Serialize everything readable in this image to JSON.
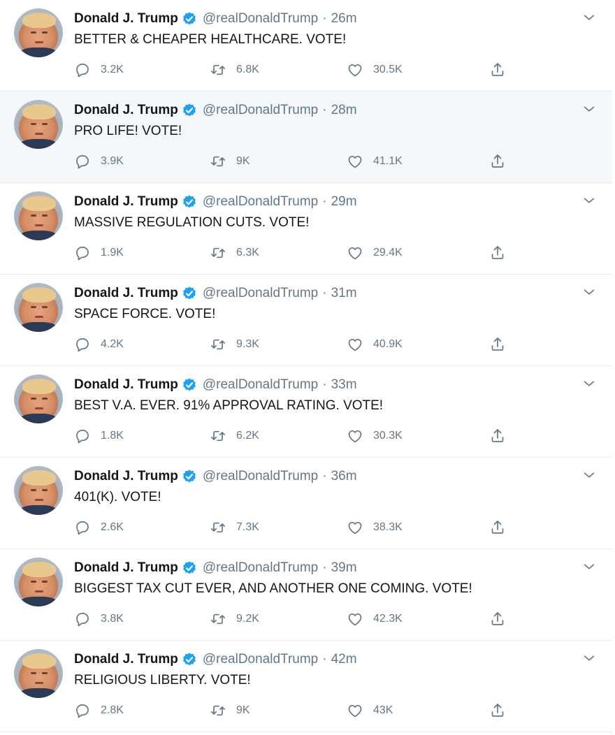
{
  "colors": {
    "name": "#14171a",
    "secondary": "#657786",
    "verified": "#1da1f2",
    "divider": "#e6ecf0",
    "hover_bg": "#f5f8fa"
  },
  "icons": {
    "reply": "reply-icon",
    "retweet": "retweet-icon",
    "like": "like-icon",
    "share": "share-icon",
    "verified": "verified-badge-icon",
    "caret": "chevron-down-icon"
  },
  "tweets": [
    {
      "name": "Donald J. Trump",
      "handle": "@realDonaldTrump",
      "sep": "·",
      "time": "26m",
      "text": "BETTER & CHEAPER HEALTHCARE. VOTE!",
      "replies": "3.2K",
      "retweets": "6.8K",
      "likes": "30.5K"
    },
    {
      "name": "Donald J. Trump",
      "handle": "@realDonaldTrump",
      "sep": "·",
      "time": "28m",
      "text": "PRO LIFE! VOTE!",
      "replies": "3.9K",
      "retweets": "9K",
      "likes": "41.1K"
    },
    {
      "name": "Donald J. Trump",
      "handle": "@realDonaldTrump",
      "sep": "·",
      "time": "29m",
      "text": "MASSIVE REGULATION CUTS. VOTE!",
      "replies": "1.9K",
      "retweets": "6.3K",
      "likes": "29.4K"
    },
    {
      "name": "Donald J. Trump",
      "handle": "@realDonaldTrump",
      "sep": "·",
      "time": "31m",
      "text": "SPACE FORCE. VOTE!",
      "replies": "4.2K",
      "retweets": "9.3K",
      "likes": "40.9K"
    },
    {
      "name": "Donald J. Trump",
      "handle": "@realDonaldTrump",
      "sep": "·",
      "time": "33m",
      "text": "BEST V.A. EVER. 91% APPROVAL RATING. VOTE!",
      "replies": "1.8K",
      "retweets": "6.2K",
      "likes": "30.3K"
    },
    {
      "name": "Donald J. Trump",
      "handle": "@realDonaldTrump",
      "sep": "·",
      "time": "36m",
      "text": "401(K). VOTE!",
      "replies": "2.6K",
      "retweets": "7.3K",
      "likes": "38.3K"
    },
    {
      "name": "Donald J. Trump",
      "handle": "@realDonaldTrump",
      "sep": "·",
      "time": "39m",
      "text": "BIGGEST TAX CUT EVER, AND ANOTHER ONE COMING. VOTE!",
      "replies": "3.8K",
      "retweets": "9.2K",
      "likes": "42.3K"
    },
    {
      "name": "Donald J. Trump",
      "handle": "@realDonaldTrump",
      "sep": "·",
      "time": "42m",
      "text": "RELIGIOUS LIBERTY. VOTE!",
      "replies": "2.8K",
      "retweets": "9K",
      "likes": "43K"
    }
  ]
}
